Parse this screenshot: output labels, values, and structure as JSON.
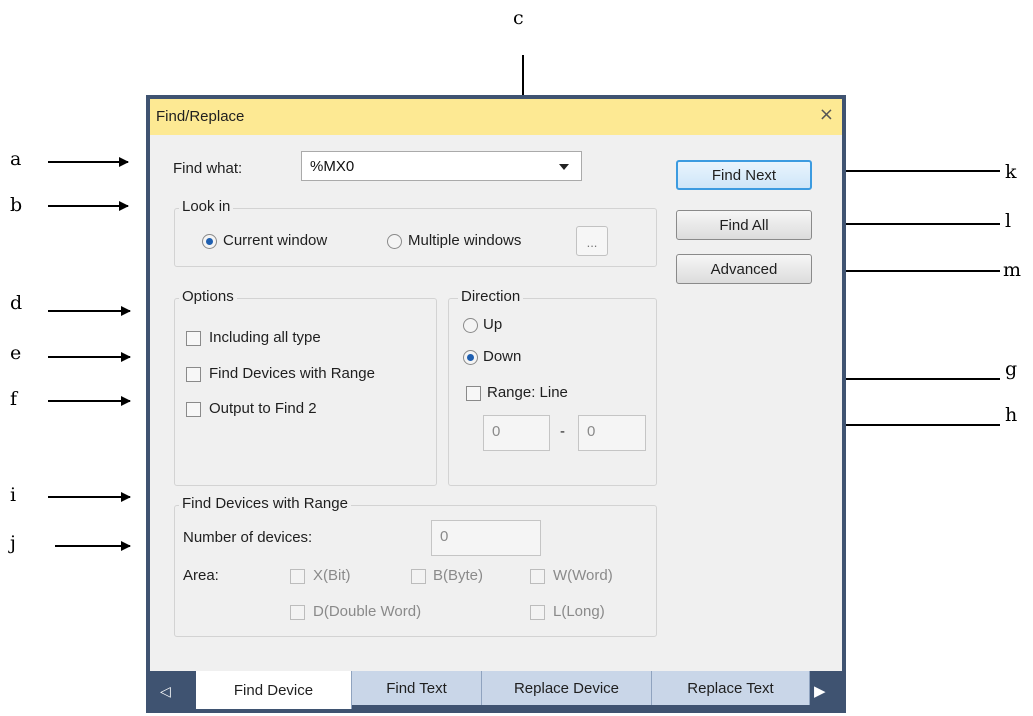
{
  "annotations": {
    "a": "a",
    "b": "b",
    "c": "c",
    "d": "d",
    "e": "e",
    "f": "f",
    "g": "g",
    "h": "h",
    "i": "i",
    "j": "j",
    "k": "k",
    "l": "l",
    "m": "m"
  },
  "dialog": {
    "title": "Find/Replace",
    "close_glyph": "×",
    "find_what_label": "Find what:",
    "find_what_value": "%MX0",
    "look_in": {
      "title": "Look in",
      "current_window": "Current window",
      "multiple_windows": "Multiple windows",
      "browse": "...",
      "selected": "current_window"
    },
    "buttons": {
      "find_next": "Find Next",
      "find_all": "Find All",
      "advanced": "Advanced"
    },
    "options": {
      "title": "Options",
      "including_all_type": "Including all type",
      "find_devices_with_range": "Find Devices with Range",
      "output_to_find2": "Output to Find 2"
    },
    "direction": {
      "title": "Direction",
      "up": "Up",
      "down": "Down",
      "selected": "down",
      "range_line": "Range: Line",
      "range_from": "0",
      "dash": "-",
      "range_to": "0"
    },
    "range_group": {
      "title": "Find Devices with Range",
      "number_label": "Number of devices:",
      "number_value": "0",
      "area_label": "Area:",
      "x_bit": "X(Bit)",
      "b_byte": "B(Byte)",
      "w_word": "W(Word)",
      "d_double_word": "D(Double Word)",
      "l_long": "L(Long)"
    },
    "tabs": [
      "Find Device",
      "Find Text",
      "Replace Device",
      "Replace Text"
    ],
    "active_tab": "Find Device"
  }
}
